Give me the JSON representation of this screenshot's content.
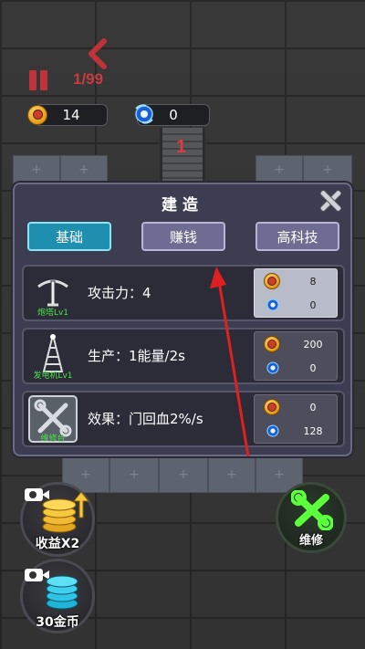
{
  "hud": {
    "wave": "1/99",
    "coins": "14",
    "energy": "0",
    "gate_number": "1"
  },
  "panel": {
    "title": "建造",
    "tabs": [
      {
        "label": "基础",
        "active": true
      },
      {
        "label": "赚钱",
        "active": false
      },
      {
        "label": "高科技",
        "active": false
      }
    ],
    "items": [
      {
        "name": "炮塔Lv1",
        "effect": "攻击力：4",
        "coin_cost": "8",
        "energy_cost": "0",
        "icon": "pickaxe-turret-icon",
        "affordable": true
      },
      {
        "name": "发电机Lv1",
        "effect": "生产：1能量/2s",
        "coin_cost": "200",
        "energy_cost": "0",
        "icon": "power-tower-icon",
        "affordable": false
      },
      {
        "name": "维修台",
        "effect": "效果：门回血2%/s",
        "coin_cost": "0",
        "energy_cost": "128",
        "icon": "repair-tools-icon",
        "affordable": false
      }
    ]
  },
  "buttons": {
    "income_x2": "收益X2",
    "coins_30": "30金币",
    "repair": "维修"
  },
  "colors": {
    "accent_red": "#c83a3e",
    "tab_active": "#1f8fb0",
    "tab_inactive": "#6e6c92",
    "label_green": "#4ce24c",
    "repair_green": "#5cff3c"
  }
}
